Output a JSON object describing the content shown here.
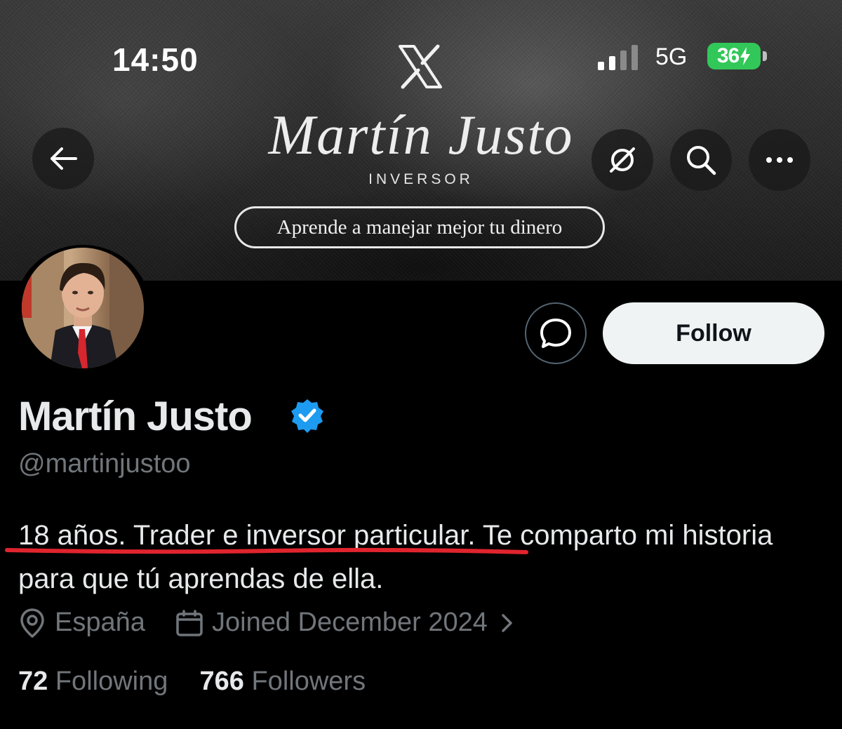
{
  "status_bar": {
    "time": "14:50",
    "network": "5G",
    "battery": "36",
    "battery_color": "#32c759"
  },
  "banner": {
    "name": "Martín Justo",
    "subtitle": "INVERSOR",
    "tagline": "Aprende a manejar mejor tu dinero"
  },
  "header_buttons": [
    {
      "icon": "back-arrow-icon"
    },
    {
      "icon": "grok-icon"
    },
    {
      "icon": "search-icon"
    },
    {
      "icon": "more-icon"
    }
  ],
  "profile": {
    "display_name": "Martín Justo",
    "verified": true,
    "verified_color": "#1d9bf0",
    "handle": "@martinjustoo",
    "bio_highlighted": "18 años. Trader e inversor particular.",
    "bio_rest": " Te comparto mi historia para que tú aprendas de ella.",
    "underline_color": "#e0242e",
    "location": "España",
    "joined": "Joined December 2024",
    "following_count": "72",
    "following_label": "Following",
    "followers_count": "766",
    "followers_label": "Followers"
  },
  "actions": {
    "follow_label": "Follow"
  }
}
